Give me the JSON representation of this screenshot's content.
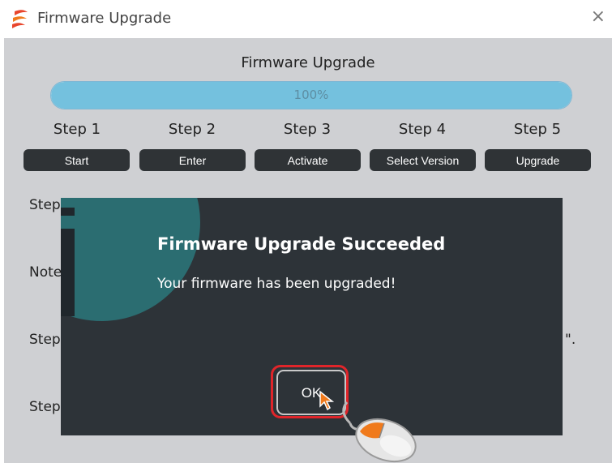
{
  "window": {
    "title": "Firmware Upgrade",
    "close_symbol": "×",
    "icon": "app-logo-icon"
  },
  "main": {
    "heading": "Firmware Upgrade",
    "progress": {
      "percent": 100,
      "text": "100%"
    },
    "steps": [
      {
        "label": "Step 1",
        "button": "Start"
      },
      {
        "label": "Step 2",
        "button": "Enter"
      },
      {
        "label": "Step 3",
        "button": "Activate"
      },
      {
        "label": "Step 4",
        "button": "Select Version"
      },
      {
        "label": "Step 5",
        "button": "Upgrade"
      }
    ],
    "background_labels": [
      "Step",
      "Note",
      "Step",
      "Step"
    ],
    "background_trailing": "\"."
  },
  "dialog": {
    "title": "Firmware Upgrade Succeeded",
    "message": "Your firmware has been upgraded!",
    "ok_label": "OK",
    "icon": "info-icon"
  },
  "colors": {
    "progress_fill": "#74c1de",
    "button_bg": "#2f3336",
    "dialog_bg": "#2d3338",
    "info_circle": "#2b6d71",
    "highlight": "#e0252a",
    "cursor": "#f07a1c"
  }
}
